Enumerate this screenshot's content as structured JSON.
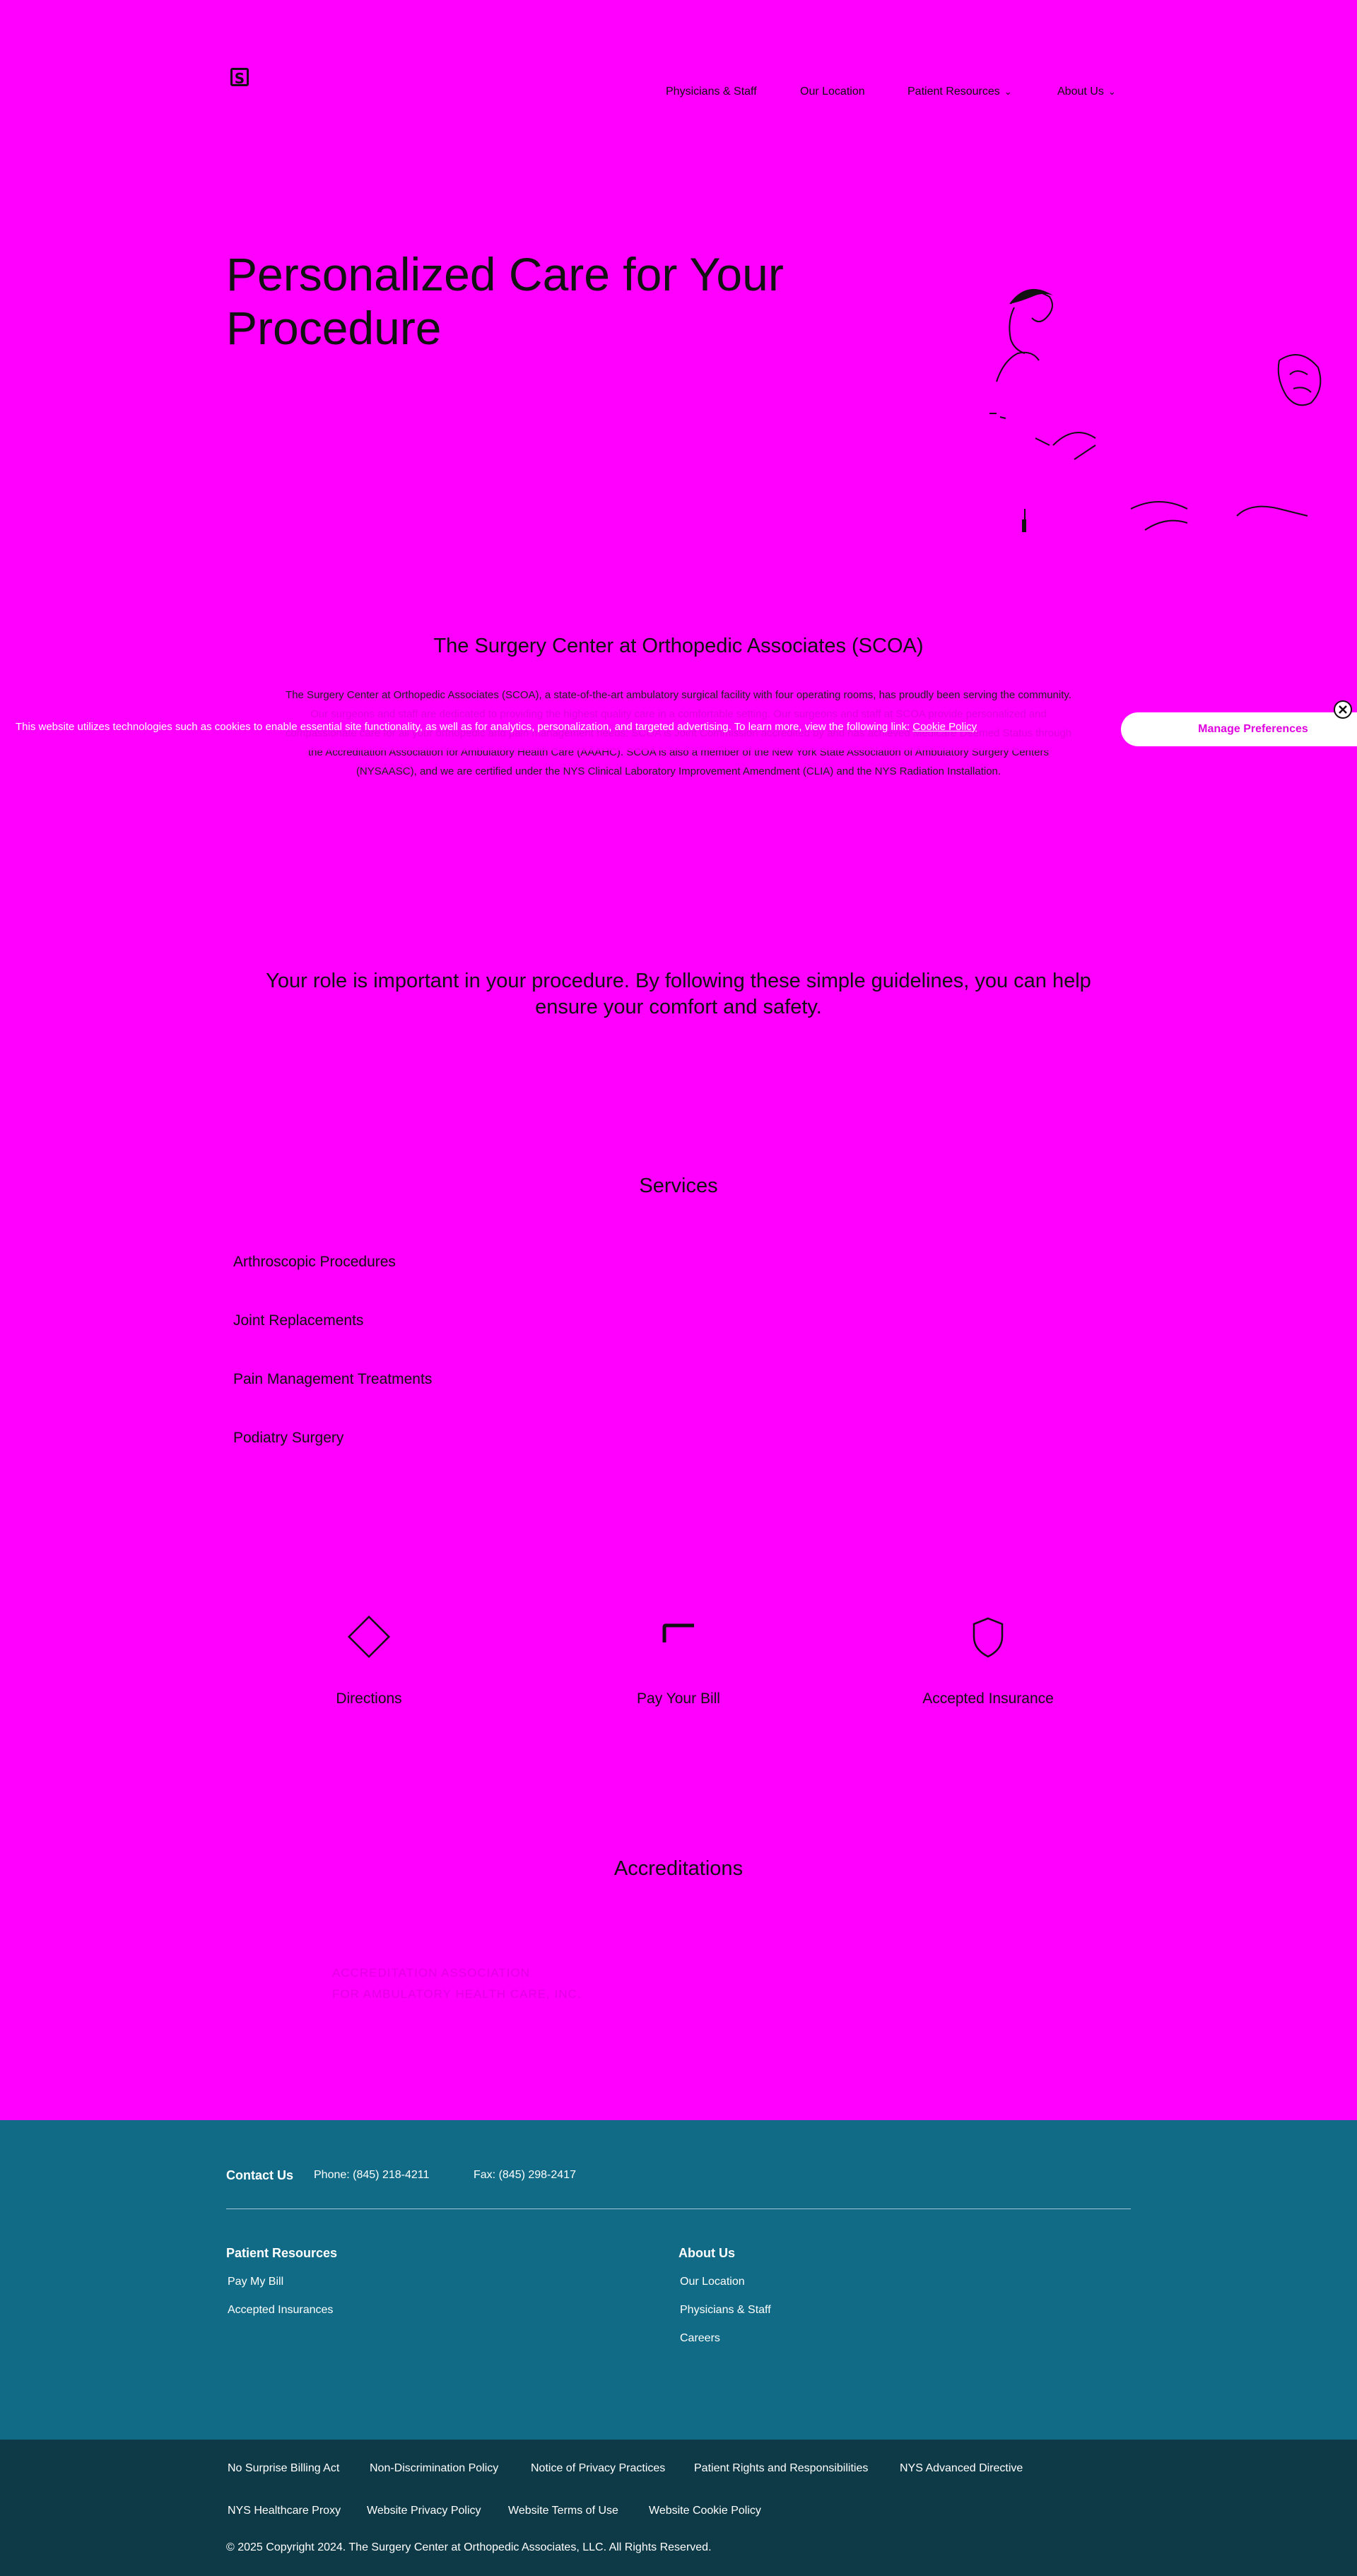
{
  "header": {
    "logo_text": "S",
    "nav": [
      {
        "label": "Physicians & Staff",
        "has_dropdown": false
      },
      {
        "label": "Our Location",
        "has_dropdown": false
      },
      {
        "label": "Patient Resources",
        "has_dropdown": true
      },
      {
        "label": "About Us",
        "has_dropdown": true
      }
    ]
  },
  "hero": {
    "title": "Personalized Care for Your Procedure"
  },
  "intro": {
    "heading": "The Surgery Center at Orthopedic Associates (SCOA)",
    "body": "The Surgery Center at Orthopedic Associates (SCOA), a state-of-the-art ambulatory surgical facility with four operating rooms, has proudly been serving the community. Our surgeons and staff are dedicated to providing the highest quality care in a comfortable setting. Our surgeons and staff at SCOA provide personalized and compassionate care for all your orthopedic and pain management needs. SCOA is Joint Commission accredited by and has achieved Medicare Deemed Status through the Accreditation Association for Ambulatory Health Care (AAAHC). SCOA is also a member of the New York State Association of Ambulatory Surgery Centers (NYSAASC), and we are certified under the NYS Clinical Laboratory Improvement Amendment (CLIA) and the NYS Radiation Installation."
  },
  "cookie_banner": {
    "text": "This website utilizes technologies such as cookies to enable essential site functionality, as well as for analytics, personalization, and targeted advertising. To learn more, view the following link:",
    "link_label": "Cookie Policy",
    "button_label": "Manage Preferences",
    "close_icon": "close-icon",
    "colors": {
      "button_text": "#e000e0"
    }
  },
  "guidelines": {
    "text": "Your role is important in your procedure. By following these simple guidelines, you can help ensure your comfort and safety."
  },
  "services": {
    "heading": "Services",
    "items": [
      "Arthroscopic Procedures",
      "Joint Replacements",
      "Pain Management Treatments",
      "Podiatry Surgery"
    ]
  },
  "features": [
    {
      "label": "Directions",
      "icon": "directions-icon"
    },
    {
      "label": "Pay Your Bill",
      "icon": "credit-card-icon"
    },
    {
      "label": "Accepted Insurance",
      "icon": "shield-icon"
    }
  ],
  "accreditations": {
    "heading": "Accreditations",
    "faint_lines": [
      "ACCREDITATION ASSOCIATION",
      "FOR AMBULATORY HEALTH CARE, INC."
    ]
  },
  "footer": {
    "contact_label": "Contact Us",
    "phone": "Phone: (845) 218-4211",
    "fax": "Fax: (845) 298-2417",
    "col1": {
      "heading": "Patient Resources",
      "links": [
        "Pay My Bill",
        "Accepted Insurances"
      ]
    },
    "col2": {
      "heading": "About Us",
      "links": [
        "Our Location",
        "Physicians & Staff",
        "Careers"
      ]
    },
    "bottom_row1": [
      "No Surprise Billing Act",
      "Non-Discrimination Policy",
      "Notice of Privacy Practices",
      "Patient Rights and Responsibilities",
      "NYS Advanced Directive"
    ],
    "bottom_row2": [
      "NYS Healthcare Proxy",
      "Website Privacy Policy",
      "Website Terms of Use",
      "Website Cookie Policy"
    ],
    "copyright": "© 2025 Copyright 2024. The Surgery Center at Orthopedic Associates, LLC. All Rights Reserved.",
    "colors": {
      "top": "#116b86",
      "bottom": "#0e3a48"
    }
  },
  "colors": {
    "page_bg": "#ff00ff"
  }
}
